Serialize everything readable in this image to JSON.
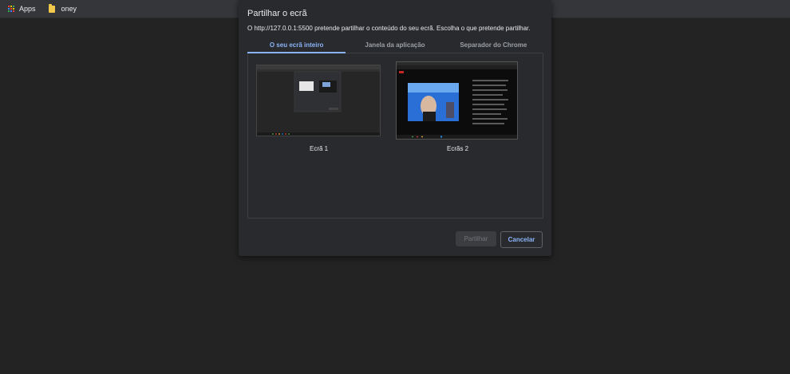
{
  "bookmarks_bar": {
    "items": [
      {
        "label": "Apps",
        "icon": "apps-grid-icon"
      },
      {
        "label": "oney",
        "icon": "folder-icon"
      }
    ]
  },
  "dialog": {
    "title": "Partilhar o ecrã",
    "description": "O http://127.0.0.1:5500 pretende partilhar o conteúdo do seu ecrã. Escolha o que pretende partilhar.",
    "tabs": [
      {
        "label": "O seu ecrã inteiro",
        "active": true
      },
      {
        "label": "Janela da aplicação",
        "active": false
      },
      {
        "label": "Separador do Chrome",
        "active": false
      }
    ],
    "screens": [
      {
        "label": "Ecrã 1"
      },
      {
        "label": "Ecrãs 2"
      }
    ],
    "buttons": {
      "share": "Partilhar",
      "cancel": "Cancelar"
    }
  },
  "colors": {
    "accent": "#8ab4f8",
    "dialog_bg": "#292a2d",
    "page_bg": "#232323"
  }
}
